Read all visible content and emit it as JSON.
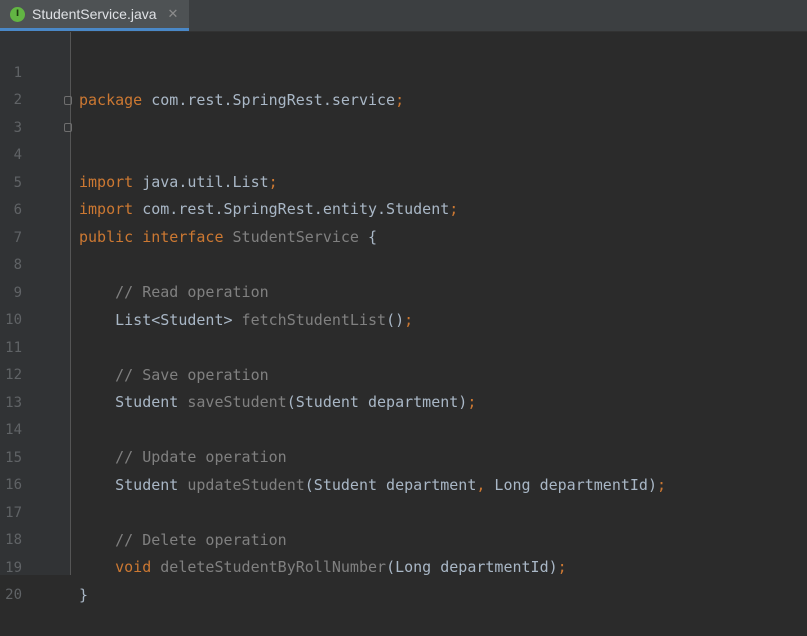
{
  "tab": {
    "icon_letter": "I",
    "title": "StudentService.java",
    "close_glyph": "✕"
  },
  "line_numbers": [
    "1",
    "2",
    "3",
    "4",
    "5",
    "6",
    "7",
    "8",
    "9",
    "10",
    "11",
    "12",
    "13",
    "14",
    "15",
    "16",
    "17",
    "18",
    "19",
    "20"
  ],
  "code": {
    "l1": {
      "kw": "package",
      "rest": " com.rest.SpringRest.service",
      "semi": ";"
    },
    "l3": {
      "kw": "import",
      "rest": " java.util.List",
      "semi": ";"
    },
    "l4": {
      "kw": "import",
      "rest": " com.rest.SpringRest.entity.Student",
      "semi": ";"
    },
    "l6": {
      "kw1": "public",
      "kw2": " interface",
      "name": " StudentService",
      "rest": " {"
    },
    "l8": {
      "comment": "    // Read operation"
    },
    "l9": {
      "type": "    List<Student>",
      "method": " fetchStudentList",
      "rest": "()",
      "semi": ";"
    },
    "l11": {
      "comment": "    // Save operation"
    },
    "l12": {
      "type": "    Student",
      "method": " saveStudent",
      "rest": "(Student department)",
      "semi": ";"
    },
    "l14": {
      "comment": "    // Update operation"
    },
    "l15": {
      "type": "    Student",
      "method": " updateStudent",
      "rest_a": "(Student department",
      "comma": ",",
      "rest_b": " Long departmentId)",
      "semi": ";"
    },
    "l17": {
      "comment": "    // Delete operation"
    },
    "l18": {
      "kw": "    void",
      "method": " deleteStudentByRollNumber",
      "rest": "(Long departmentId)",
      "semi": ";"
    },
    "l19": {
      "rest": "}"
    }
  },
  "colors": {
    "background": "#2b2b2b",
    "gutter": "#313335",
    "keyword": "#cc7832",
    "comment": "#808080",
    "text": "#a9b7c6",
    "tab_accent": "#4a88c7"
  }
}
